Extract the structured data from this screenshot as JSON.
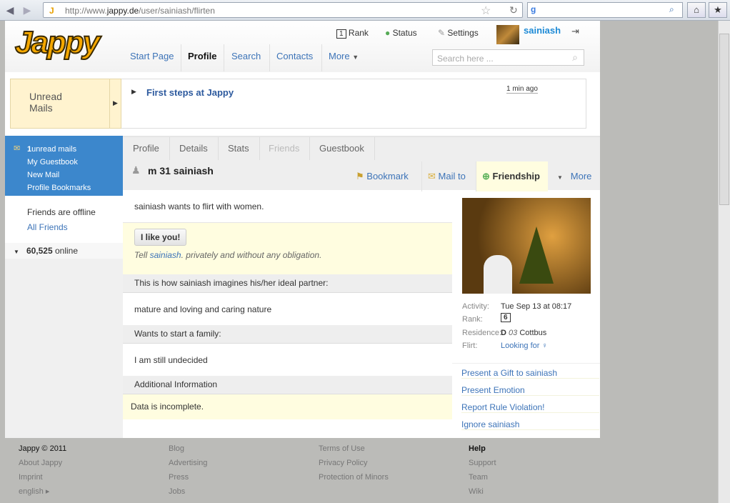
{
  "browser": {
    "url_prefix": "http://www.",
    "url_domain": "jappy.de",
    "url_path": "/user/sainiash/flirten"
  },
  "header": {
    "logo": "Jappy",
    "rank": "Rank",
    "rank_num": "1",
    "status": "Status",
    "settings": "Settings",
    "username": "sainiash",
    "nav": [
      "Start Page",
      "Profile",
      "Search",
      "Contacts",
      "More"
    ],
    "search_placeholder": "Search here ..."
  },
  "unread_box": {
    "line1": "Unread",
    "line2": "Mails"
  },
  "news": {
    "title": "First steps at Jappy",
    "time": "1 min ago"
  },
  "sidebar": {
    "unread_count": "1",
    "unread_label": "unread mails",
    "links": [
      "My Guestbook",
      "New Mail",
      "Profile Bookmarks"
    ],
    "friends_offline": "Friends are offline",
    "all_friends": "All Friends",
    "online_count": "60,525",
    "online_label": "online"
  },
  "profile": {
    "tabs": [
      "Profile",
      "Details",
      "Stats",
      "Friends",
      "Guestbook"
    ],
    "title": "m 31 sainiash",
    "actions": {
      "bookmark": "Bookmark",
      "mail": "Mail to",
      "friendship": "Friendship",
      "more": "More"
    },
    "flirt_text": "sainiash wants to flirt with women.",
    "like_button": "I like you!",
    "tell_pre": "Tell ",
    "tell_name": "sainiash",
    "tell_post": ". privately and without any obligation.",
    "sections": [
      {
        "heading": "This is how sainiash imagines his/her ideal partner:",
        "text": "mature and loving and caring nature"
      },
      {
        "heading": "Wants to start a family:",
        "text": "I am still undecided"
      },
      {
        "heading": "Additional Information",
        "text": "Data is incomplete."
      }
    ],
    "info": {
      "activity_label": "Activity:",
      "activity": "Tue Sep 13 at 08:17",
      "rank_label": "Rank:",
      "rank": "6",
      "residence_label": "Residence:",
      "res_country": "D",
      "res_code": "03",
      "res_city": "Cottbus",
      "flirt_label": "Flirt:",
      "flirt": "Looking for ♀"
    },
    "links": [
      "Present a Gift to sainiash",
      "Present Emotion",
      "Report Rule Violation!",
      "Ignore sainiash"
    ]
  },
  "footer": {
    "cols": [
      [
        "Jappy © 2011",
        "About Jappy",
        "Imprint",
        "english ▸"
      ],
      [
        "Blog",
        "Advertising",
        "Press",
        "Jobs"
      ],
      [
        "Terms of Use",
        "Privacy Policy",
        "Protection of Minors"
      ],
      [
        "Help",
        "Support",
        "Team",
        "Wiki"
      ]
    ]
  }
}
